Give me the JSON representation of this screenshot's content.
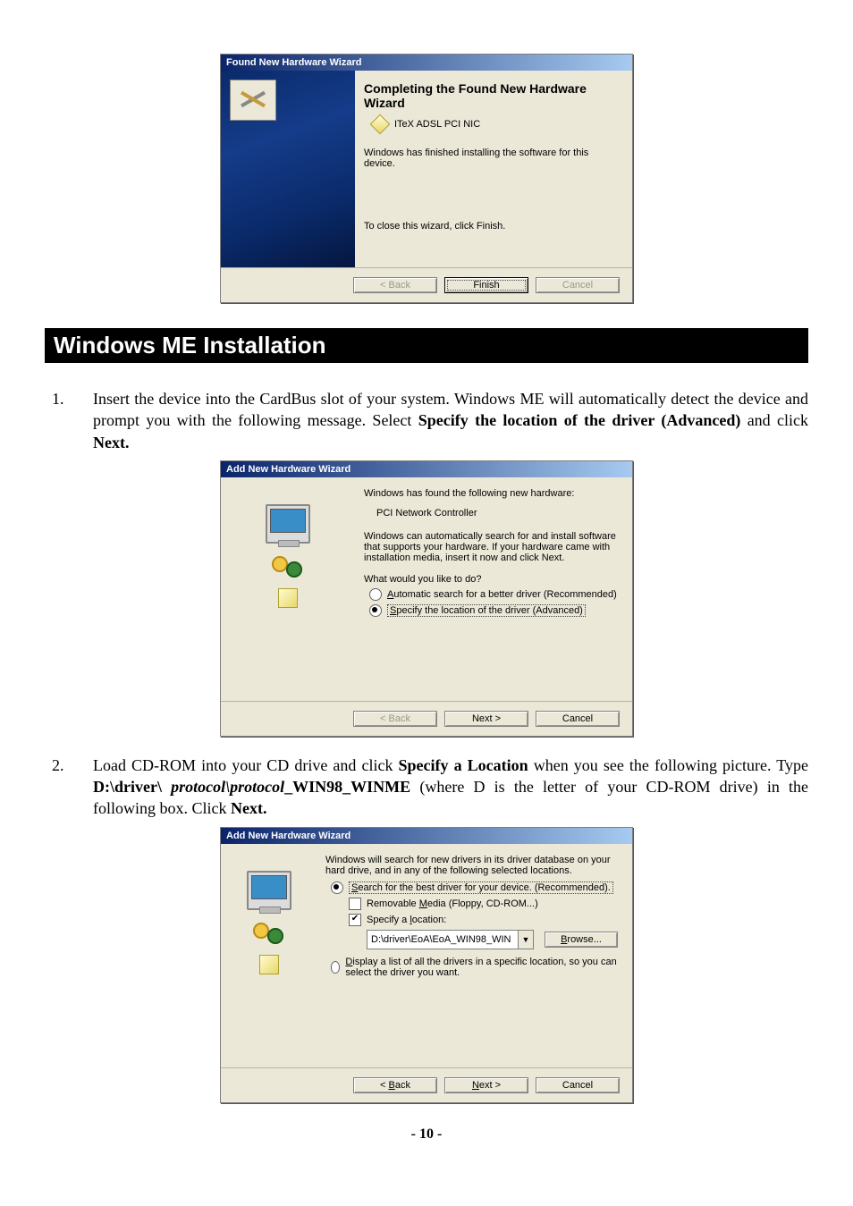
{
  "wizard1": {
    "title": "Found New Hardware Wizard",
    "heading": "Completing the Found New Hardware Wizard",
    "device": "ITeX ADSL PCI NIC",
    "status": "Windows has finished installing the software for this device.",
    "close_hint": "To close this wizard, click Finish.",
    "back": "< Back",
    "finish": "Finish",
    "cancel": "Cancel"
  },
  "section_title": "Windows ME Installation",
  "step1": {
    "num": "1.",
    "pre": "Insert the device into the CardBus slot of your system.  Windows ME will automatically detect the device and prompt you with the following message.  Select ",
    "bold1": "Specify the location of the driver (Advanced)",
    "mid": " and click ",
    "bold2": "Next."
  },
  "wizard2": {
    "title": "Add New Hardware Wizard",
    "found": "Windows has found the following new hardware:",
    "device": "PCI Network Controller",
    "desc": "Windows can automatically search for and install software that supports your hardware. If your hardware came with installation media, insert it now and click Next.",
    "question": "What would you like to do?",
    "opt1_prefix": "A",
    "opt1_rest": "utomatic search for a better driver (Recommended)",
    "opt2_prefix": "S",
    "opt2_rest": "pecify the location of the driver (Advanced)",
    "back": "< Back",
    "next": "Next >",
    "cancel": "Cancel"
  },
  "step2": {
    "num": "2.",
    "pre": "Load CD-ROM into your CD drive and click ",
    "bold1": "Specify a Location",
    "mid1": " when you see the following picture. Type ",
    "bold2": "D:\\driver\\",
    "ital": " protocol\\protocol",
    "bold3": "_WIN98_WINME",
    "mid2": " (where D is the letter of your CD-ROM drive) in the following box. Click ",
    "bold4": "Next."
  },
  "wizard3": {
    "title": "Add New Hardware Wizard",
    "desc": "Windows will search for new drivers in its driver database on your hard drive, and in any of the following selected locations.",
    "opt1_prefix": "S",
    "opt1_rest": "earch for the best driver for your device. (Recommended).",
    "chk1_pre": "Removable ",
    "chk1_u": "M",
    "chk1_post": "edia (Floppy, CD-ROM...)",
    "chk2_pre": "Specify a ",
    "chk2_u": "l",
    "chk2_post": "ocation:",
    "path": "D:\\driver\\EoA\\EoA_WIN98_WIN",
    "browse_u": "B",
    "browse_rest": "rowse...",
    "opt2_prefix": "D",
    "opt2_rest": "isplay a list of all the drivers in a specific location, so you can select the driver you want.",
    "back_u": "B",
    "back_rest": "ack",
    "next_u": "N",
    "next_rest": "ext >",
    "cancel": "Cancel"
  },
  "page_number": "- 10 -"
}
